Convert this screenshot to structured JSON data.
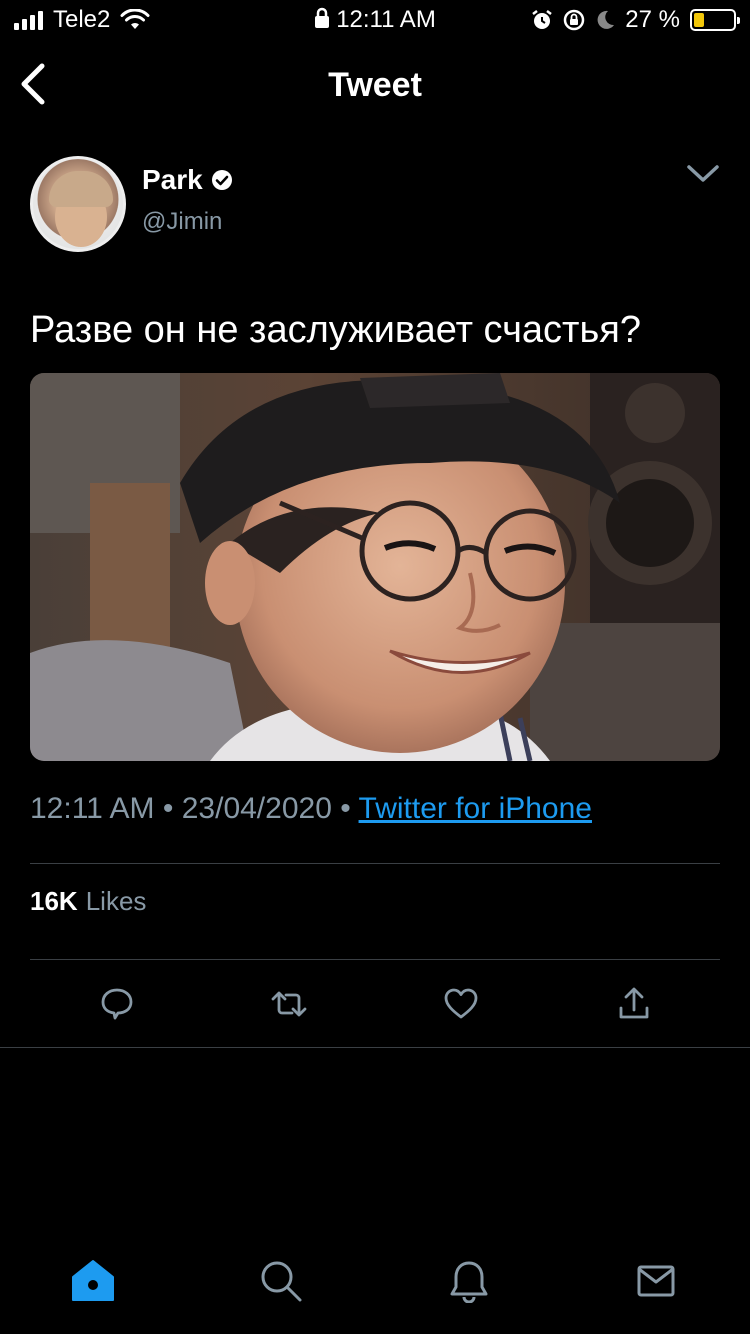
{
  "status_bar": {
    "carrier": "Tele2",
    "time": "12:11 AM",
    "battery_percent": "27 %",
    "battery_level": 0.27,
    "icons": [
      "signal-icon",
      "wifi-icon",
      "lock-icon",
      "alarm-icon",
      "rotation-lock-icon",
      "moon-icon",
      "battery-icon"
    ]
  },
  "header": {
    "title": "Tweet",
    "back_icon": "chevron-left-icon"
  },
  "tweet": {
    "author_name": "Park",
    "verified": true,
    "author_handle": "@Jimin",
    "text": "Разве он не заслуживает счастья?",
    "time": "12:11 AM",
    "separator": "•",
    "date": "23/04/2020",
    "source": "Twitter for iPhone",
    "likes_count": "16K",
    "likes_label": "Likes"
  },
  "actions": [
    "reply-icon",
    "retweet-icon",
    "like-icon",
    "share-icon"
  ],
  "tabbar": {
    "items": [
      "home-icon",
      "search-icon",
      "notifications-icon",
      "messages-icon"
    ],
    "active": "home-icon",
    "accent": "#1d9bf0"
  },
  "colors": {
    "background": "#000000",
    "secondary_text": "#8899a6",
    "link": "#1d9bf0",
    "divider": "#3a3f44"
  }
}
